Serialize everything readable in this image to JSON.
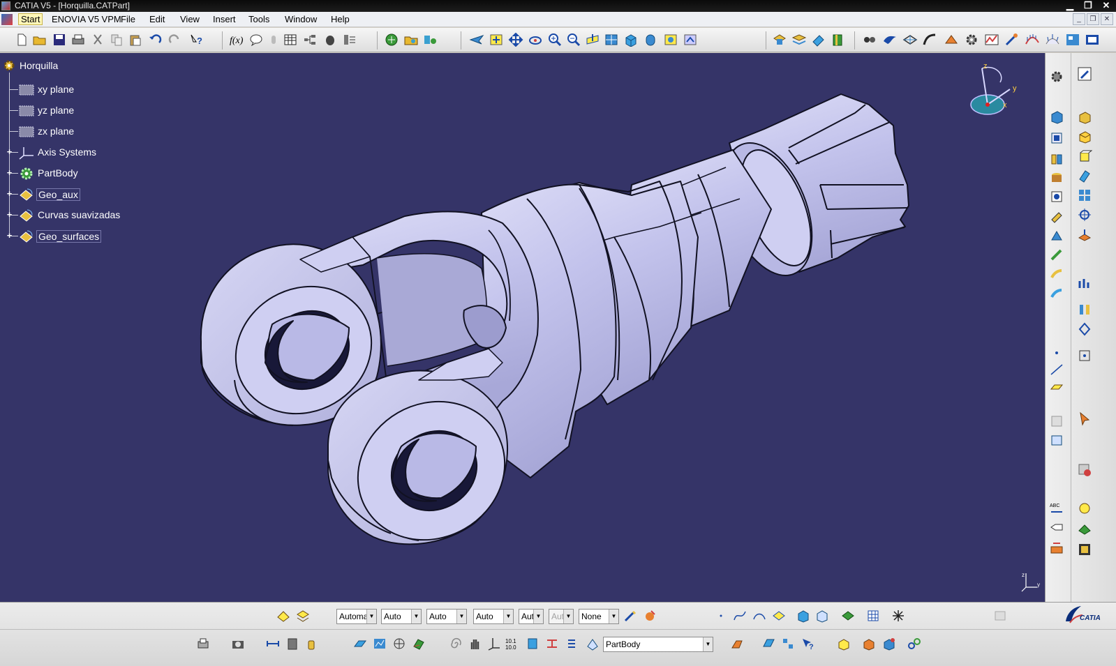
{
  "window": {
    "title": "CATIA V5 - [Horquilla.CATPart]",
    "controls": [
      "minimize",
      "restore",
      "close"
    ]
  },
  "menubar": {
    "items": [
      "Start",
      "ENOVIA V5 VPM",
      "File",
      "Edit",
      "View",
      "Insert",
      "Tools",
      "Window",
      "Help"
    ]
  },
  "tree": {
    "root": "Horquilla",
    "nodes": [
      {
        "label": "xy plane",
        "icon": "plane-icon",
        "expandable": false
      },
      {
        "label": "yz plane",
        "icon": "plane-icon",
        "expandable": false
      },
      {
        "label": "zx plane",
        "icon": "plane-icon",
        "expandable": false
      },
      {
        "label": "Axis Systems",
        "icon": "axis-system-icon",
        "expandable": true
      },
      {
        "label": "PartBody",
        "icon": "partbody-icon",
        "expandable": true
      },
      {
        "label": "Geo_aux",
        "icon": "geometrical-set-icon",
        "expandable": true
      },
      {
        "label": "Curvas suavizadas",
        "icon": "geometrical-set-icon",
        "expandable": true
      },
      {
        "label": "Geo_surfaces",
        "icon": "geometrical-set-icon",
        "expandable": true
      }
    ]
  },
  "compass": {
    "axes": [
      "z",
      "y",
      "x"
    ]
  },
  "bottom": {
    "combos": [
      {
        "name": "combo-automatic",
        "value": "Automa",
        "enabled": true
      },
      {
        "name": "combo-auto-1",
        "value": "Auto",
        "enabled": true
      },
      {
        "name": "combo-auto-2",
        "value": "Auto",
        "enabled": true
      },
      {
        "name": "combo-auto-3",
        "value": "Auto",
        "enabled": true
      },
      {
        "name": "combo-aut-4",
        "value": "Aut",
        "enabled": true
      },
      {
        "name": "combo-aut-5",
        "value": "Aut",
        "enabled": false
      },
      {
        "name": "combo-none",
        "value": "None",
        "enabled": true
      }
    ],
    "body_select": "PartBody",
    "logo": "CATIA"
  },
  "colors": {
    "viewport_bg": "#353468",
    "part_fill": "#c6c6ee",
    "part_edge": "#111122",
    "tree_text": "#ffffff"
  }
}
